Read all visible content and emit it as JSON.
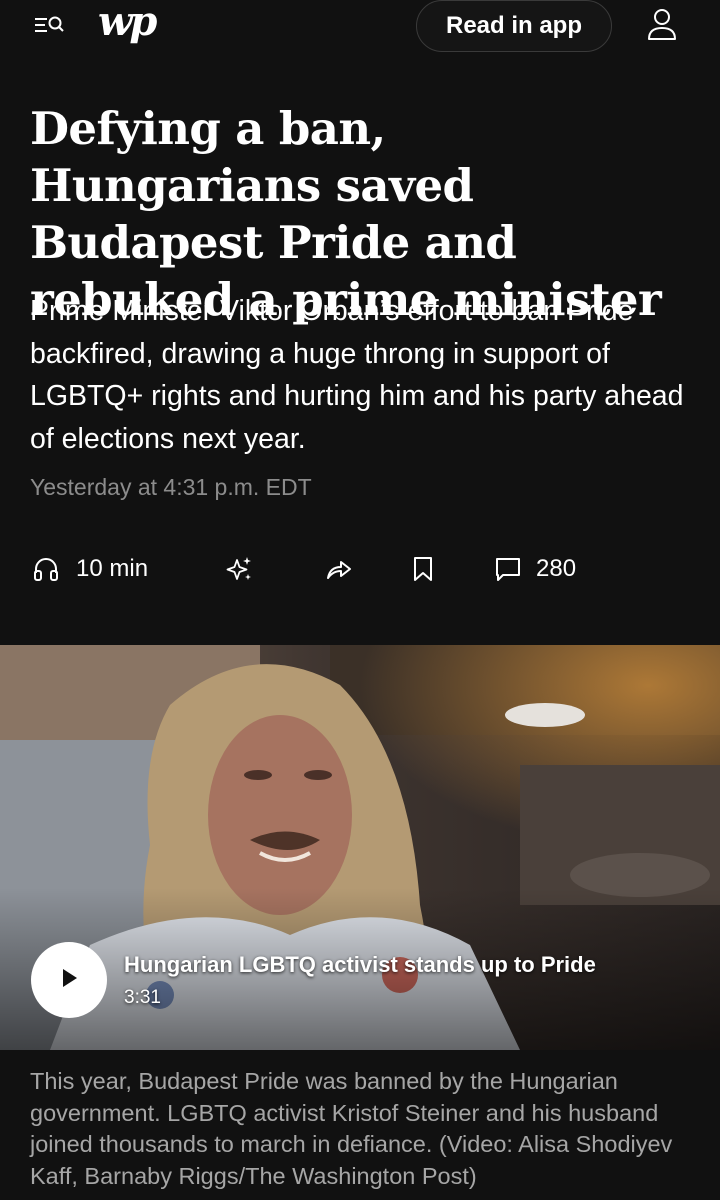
{
  "header": {
    "logo_text": "wp",
    "read_in_app_label": "Read in app",
    "menu_icon": "menu-search-icon",
    "account_icon": "user-icon"
  },
  "article": {
    "headline": "Defying a ban, Hungarians saved Budapest Pride and rebuked a prime minister",
    "dek": "Prime Minister Viktor Orban’s effort to ban Pride backfired, drawing a huge throng in support of LGBTQ+ rights and hurting him and his party ahead of elections next year.",
    "timestamp": "Yesterday at 4:31 p.m. EDT"
  },
  "actions": {
    "listen_label": "10 min",
    "listen_icon": "headphones-icon",
    "ai_icon": "sparkles-icon",
    "share_icon": "share-icon",
    "bookmark_icon": "bookmark-icon",
    "comments_icon": "comment-icon",
    "comments_count": "280"
  },
  "video": {
    "title": "Hungarian LGBTQ activist stands up to Pride",
    "duration": "3:31",
    "play_icon": "play-icon",
    "caption": "This year, Budapest Pride was banned by the Hungarian government. LGBTQ activist Kristof Steiner and his husband joined thousands to march in defiance. (Video: Alisa Shodiyev Kaff, Barnaby Riggs/The Washington Post)"
  },
  "colors": {
    "background": "#111111",
    "text": "#ffffff",
    "muted": "#8c8c8c",
    "caption": "#a6a6a6"
  }
}
